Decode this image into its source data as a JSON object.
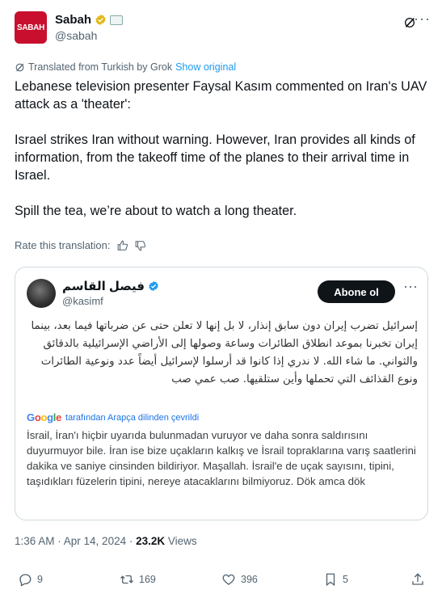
{
  "author": {
    "name": "Sabah",
    "handle": "@sabah",
    "avatar_text": "SABAH",
    "brand_color": "#c8102e",
    "verified_color": "#e2b719"
  },
  "translation": {
    "prefix": "Translated from Turkish by Grok",
    "link": "Show original"
  },
  "body": {
    "p1": "Lebanese television presenter Faysal Kasım commented on Iran's UAV attack as a 'theater':",
    "p2": "Israel strikes Iran without warning. However, Iran provides all kinds of information, from the takeoff time of the planes to their arrival time in Israel.",
    "p3": "Spill the tea, we’re about to watch a long theater."
  },
  "rate": {
    "label": "Rate this translation:"
  },
  "quote": {
    "name": "فيصل القاسم",
    "handle": "@kasimf",
    "follow_label": "Abone ol",
    "arabic_text": "إسرائيل تضرب إيران دون سابق إنذار، لا بل إنها لا تعلن حتى عن ضرباتها فيما بعد، بينما إيران تخبرنا بموعد انطلاق الطائرات وساعة وصولها إلى الأراضي الإسرائيلية بالدقائق والثواني. ما شاء الله. لا ندري إذا كانوا قد أرسلوا لإسرائيل أيضاً عدد ونوعية الطائرات ونوع القذائف التي تحملها وأين ستلقيها. صب عمي صب",
    "google_translated": "tarafından Arapça dilinden çevrildi",
    "turkish_text": "İsrail, İran'ı hiçbir uyarıda bulunmadan vuruyor ve daha sonra saldırısını duyurmuyor bile. İran ise bize uçakların kalkış ve İsrail topraklarına varış saatlerini dakika ve saniye cinsinden bildiriyor. Maşallah. İsrail'e de uçak sayısını, tipini, taşıdıkları füzelerin tipini, nereye atacaklarını bilmiyoruz. Dök amca dök"
  },
  "meta": {
    "timestamp": "1:36 AM · Apr 14, 2024 · ",
    "views_count": "23.2K",
    "views_label": " Views"
  },
  "actions": {
    "replies": "9",
    "reposts": "169",
    "likes": "396",
    "bookmarks": "5"
  },
  "colors": {
    "link": "#1d9bf0",
    "muted": "#536471",
    "text": "#0f1419"
  }
}
